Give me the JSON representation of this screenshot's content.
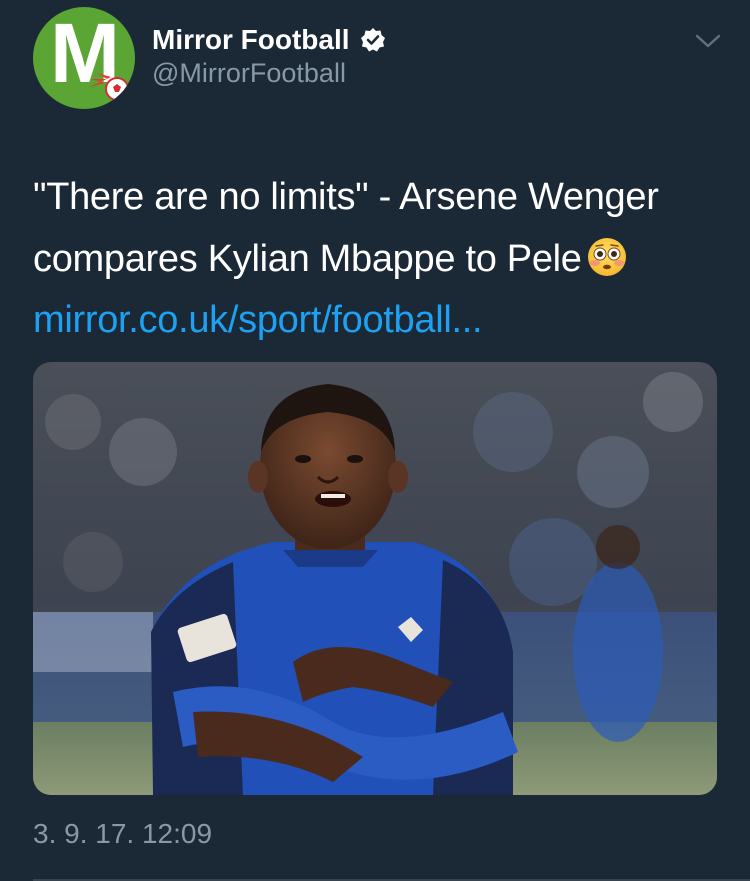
{
  "author": {
    "display_name": "Mirror Football",
    "handle": "@MirrorFootball",
    "avatar_letter": "M",
    "verified": true,
    "avatar_bg_color": "#5aa533"
  },
  "tweet": {
    "text": "\"There are no limits\" - Arsene Wenger compares Kylian Mbappe to Pele",
    "emoji": "flushed-face",
    "link_text": "mirror.co.uk/sport/football...",
    "timestamp": "3. 9. 17. 12:09"
  },
  "icons": {
    "verified": "verified-badge-icon",
    "menu": "chevron-down-icon"
  },
  "colors": {
    "background": "#1b2836",
    "text": "#ffffff",
    "secondary_text": "#8899a6",
    "link": "#1da1f2"
  }
}
